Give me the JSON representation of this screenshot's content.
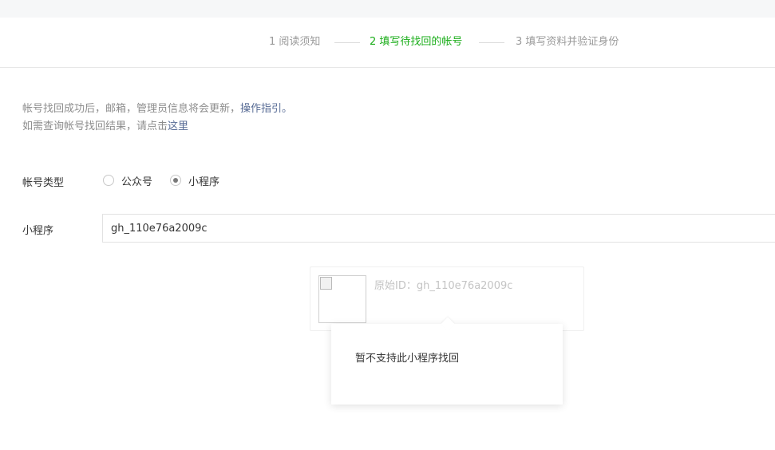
{
  "steps": [
    {
      "label": "1 阅读须知"
    },
    {
      "label": "2 填写待找回的帐号"
    },
    {
      "label": "3 填写资料并验证身份"
    }
  ],
  "notice": {
    "line1_text": "帐号找回成功后，邮箱，管理员信息将会更新，",
    "line1_link": "操作指引。",
    "line2_text": "如需查询帐号找回结果，请点击",
    "line2_link": "这里"
  },
  "form": {
    "account_type_label": "帐号类型",
    "options": [
      {
        "label": "公众号",
        "checked": false
      },
      {
        "label": "小程序",
        "checked": true
      }
    ],
    "miniprogram_label": "小程序",
    "miniprogram_value": "gh_110e76a2009c"
  },
  "result": {
    "original_id": "原始ID：gh_110e76a2009c"
  },
  "tooltip": {
    "message": "暂不支持此小程序找回"
  },
  "colors": {
    "active_step": "#1aad19",
    "link": "#576b95"
  }
}
